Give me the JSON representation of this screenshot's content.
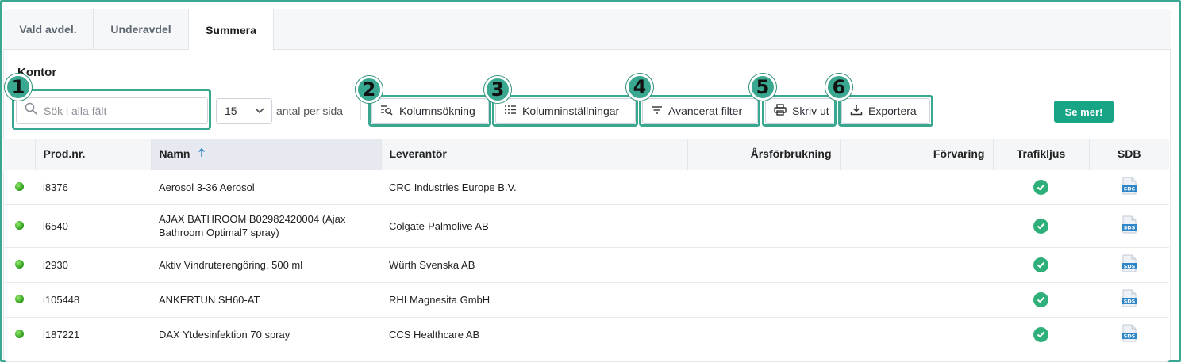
{
  "tabs": [
    {
      "label": "Vald avdel.",
      "active": false
    },
    {
      "label": "Underavdel",
      "active": false
    },
    {
      "label": "Summera",
      "active": true
    }
  ],
  "section_title": "Kontor",
  "search": {
    "placeholder": "Sök i alla fält",
    "value": ""
  },
  "per_page": {
    "value": "15",
    "label": "antal per sida"
  },
  "toolbar": {
    "column_search": "Kolumnsökning",
    "column_settings": "Kolumninställningar",
    "advanced_filter": "Avancerat filter",
    "print": "Skriv ut",
    "export": "Exportera",
    "see_more": "Se mer!"
  },
  "callouts": [
    "1",
    "2",
    "3",
    "4",
    "5",
    "6"
  ],
  "table": {
    "columns": [
      "",
      "Prod.nr.",
      "Namn",
      "Leverantör",
      "Årsförbrukning",
      "Förvaring",
      "Trafikljus",
      "SDB"
    ],
    "sorted_column": "Namn",
    "sort_direction": "ascending",
    "rows": [
      {
        "prod_nr": "i8376",
        "name": "Aerosol 3-36 Aerosol",
        "supplier": "CRC Industries Europe B.V.",
        "annual_use": "",
        "storage": "",
        "status": "green",
        "traffic_light": "ok",
        "sdb_icon": "SDS"
      },
      {
        "prod_nr": "i6540",
        "name": "AJAX BATHROOM B02982420004 (Ajax Bathroom Optimal7 spray)",
        "supplier": "Colgate-Palmolive AB",
        "annual_use": "",
        "storage": "",
        "status": "green",
        "traffic_light": "ok",
        "sdb_icon": "SDS"
      },
      {
        "prod_nr": "i2930",
        "name": "Aktiv Vindruterengöring, 500 ml",
        "supplier": "Würth Svenska AB",
        "annual_use": "",
        "storage": "",
        "status": "green",
        "traffic_light": "ok",
        "sdb_icon": "SDS"
      },
      {
        "prod_nr": "i105448",
        "name": "ANKERTUN SH60-AT",
        "supplier": "RHI Magnesita GmbH",
        "annual_use": "",
        "storage": "",
        "status": "green",
        "traffic_light": "ok",
        "sdb_icon": "SDS"
      },
      {
        "prod_nr": "i187221",
        "name": "DAX Ytdesinfektion 70 spray",
        "supplier": "CCS Healthcare AB",
        "annual_use": "",
        "storage": "",
        "status": "green",
        "traffic_light": "ok",
        "sdb_icon": "SDS"
      }
    ]
  },
  "colors": {
    "accent": "#3aa890",
    "button_green": "#18a586",
    "check_green": "#2fb07a",
    "sds_blue": "#2e86c9"
  }
}
